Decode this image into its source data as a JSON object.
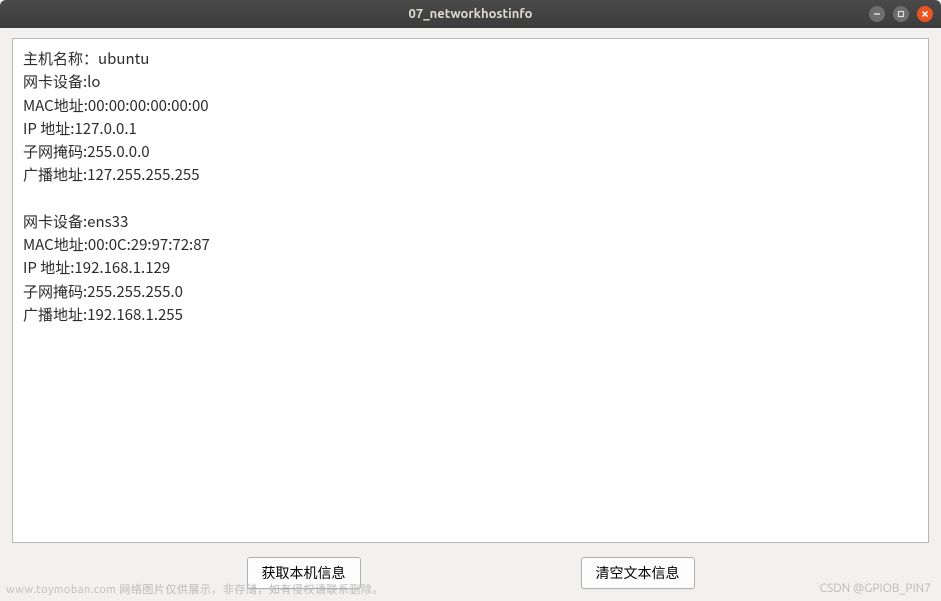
{
  "window": {
    "title": "07_networkhostinfo"
  },
  "textarea": {
    "content": "主机名称：ubuntu\n网卡设备:lo\nMAC地址:00:00:00:00:00:00\nIP 地址:127.0.0.1\n子网掩码:255.0.0.0\n广播地址:127.255.255.255\n\n网卡设备:ens33\nMAC地址:00:0C:29:97:72:87\nIP 地址:192.168.1.129\n子网掩码:255.255.255.0\n广播地址:192.168.1.255\n"
  },
  "buttons": {
    "get_info": "获取本机信息",
    "clear_info": "清空文本信息"
  },
  "watermark": {
    "left": "www.toymoban.com 网络图片仅供展示，非存储，如有侵权请联系删除。",
    "right": "CSDN @GPIOB_PIN7"
  }
}
